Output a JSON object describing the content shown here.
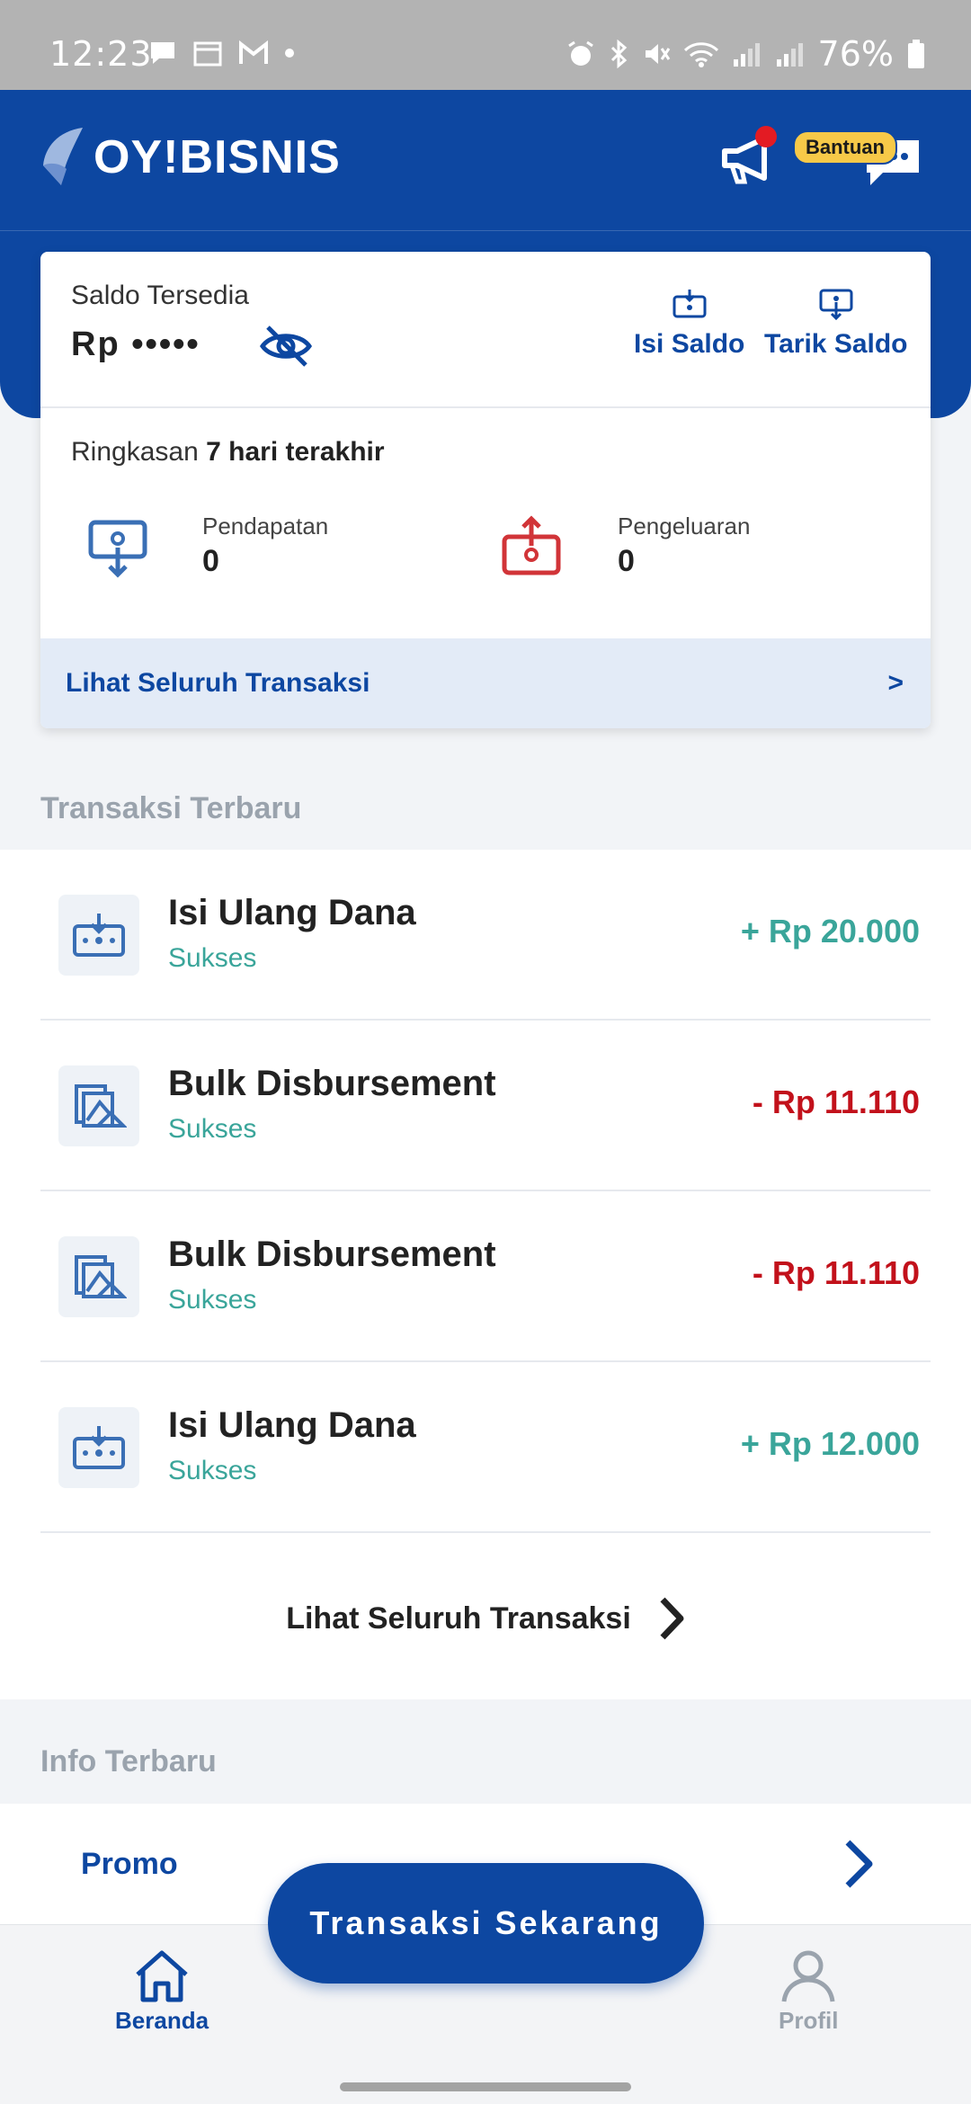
{
  "status_bar": {
    "time": "12:23",
    "battery": "76%"
  },
  "header": {
    "logo_text": "OY!BISNIS",
    "help_badge": "Bantuan"
  },
  "balance_card": {
    "label": "Saldo Tersedia",
    "value_masked": "Rp •••••",
    "actions": [
      {
        "label": "Isi Saldo",
        "icon": "topup-icon"
      },
      {
        "label": "Tarik Saldo",
        "icon": "withdraw-icon"
      }
    ],
    "summary_prefix": "Ringkasan",
    "summary_period": "7 hari terakhir",
    "income_label": "Pendapatan",
    "income_value": "0",
    "expense_label": "Pengeluaran",
    "expense_value": "0",
    "footer_link": "Lihat Seluruh Transaksi",
    "footer_chevron": ">"
  },
  "recent": {
    "title": "Transaksi Terbaru",
    "items": [
      {
        "title": "Isi Ulang Dana",
        "status": "Sukses",
        "amount": "+ Rp 20.000",
        "type": "in"
      },
      {
        "title": "Bulk Disbursement",
        "status": "Sukses",
        "amount": "- Rp 11.110",
        "type": "out"
      },
      {
        "title": "Bulk Disbursement",
        "status": "Sukses",
        "amount": "- Rp 11.110",
        "type": "out"
      },
      {
        "title": "Isi Ulang Dana",
        "status": "Sukses",
        "amount": "+ Rp 12.000",
        "type": "in"
      }
    ],
    "see_all": "Lihat Seluruh Transaksi"
  },
  "info": {
    "title": "Info Terbaru",
    "promo": "Promo"
  },
  "fab": {
    "label": "Transaksi Sekarang"
  },
  "bottom_nav": {
    "home": "Beranda",
    "profile": "Profil"
  },
  "colors": {
    "brand": "#0d47a1",
    "positive": "#3aa59a",
    "negative": "#c2111b"
  }
}
